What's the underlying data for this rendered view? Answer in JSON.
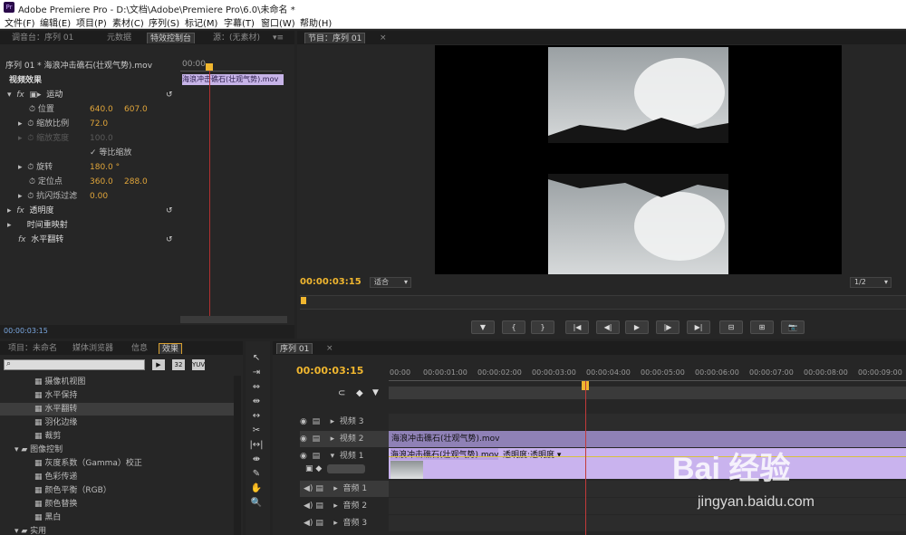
{
  "window": {
    "title": "Adobe Premiere Pro - D:\\文档\\Adobe\\Premiere Pro\\6.0\\未命名 *",
    "app_icon": "Pr"
  },
  "menu": [
    "文件(F)",
    "编辑(E)",
    "项目(P)",
    "素材(C)",
    "序列(S)",
    "标记(M)",
    "字幕(T)",
    "窗口(W)",
    "帮助(H)"
  ],
  "source_tabs": [
    "调音台：序列 01",
    "元数据",
    "特效控制台",
    "源：(无素材)"
  ],
  "effect_controls": {
    "clip_title": "序列 01 * 海浪冲击礁石(壮观气势).mov",
    "timecode_start": "00:00",
    "video_effects": "视频效果",
    "motion": "运动",
    "position": {
      "label": "位置",
      "x": "640.0",
      "y": "607.0"
    },
    "scale": {
      "label": "缩放比例",
      "value": "72.0"
    },
    "scale_width": {
      "label": "缩放宽度",
      "value": "100.0"
    },
    "uniform": "等比缩放",
    "rotation": {
      "label": "旋转",
      "value": "180.0 °"
    },
    "anchor": {
      "label": "定位点",
      "x": "360.0",
      "y": "288.0"
    },
    "antiflicker": {
      "label": "抗闪烁过滤",
      "value": "0.00"
    },
    "opacity": "透明度",
    "time_remap": "时间重映射",
    "hflip": "水平翻转",
    "clip_bar": "海浪冲击礁石(壮观气势).mov",
    "bottom_tc": "00:00:03:15"
  },
  "program": {
    "tab": "节目：序列 01",
    "timecode": "00:00:03:15",
    "fit": "适合",
    "res": "1/2",
    "buttons": [
      "▼",
      "{",
      "}",
      "|◀",
      "◀|",
      "▶",
      "|▶",
      "▶|",
      "⊟",
      "⊞",
      "📷"
    ]
  },
  "project_tabs": [
    "项目：未命名",
    "媒体浏览器",
    "信息",
    "效果"
  ],
  "effects_list": [
    {
      "label": "摄像机视图",
      "indent": 2
    },
    {
      "label": "水平保持",
      "indent": 2
    },
    {
      "label": "水平翻转",
      "indent": 2,
      "selected": true
    },
    {
      "label": "羽化边缘",
      "indent": 2
    },
    {
      "label": "裁剪",
      "indent": 2
    },
    {
      "label": "图像控制",
      "indent": 1,
      "folder": true
    },
    {
      "label": "灰度系数（Gamma）校正",
      "indent": 2
    },
    {
      "label": "色彩传递",
      "indent": 2
    },
    {
      "label": "颜色平衡（RGB）",
      "indent": 2
    },
    {
      "label": "颜色替换",
      "indent": 2
    },
    {
      "label": "黑白",
      "indent": 2
    },
    {
      "label": "实用",
      "indent": 1,
      "folder": true
    }
  ],
  "timeline": {
    "tab": "序列 01",
    "timecode": "00:00:03:15",
    "ticks": [
      "00:00",
      "00:00:01:00",
      "00:00:02:00",
      "00:00:03:00",
      "00:00:04:00",
      "00:00:05:00",
      "00:00:06:00",
      "00:00:07:00",
      "00:00:08:00",
      "00:00:09:00"
    ],
    "video_tracks": [
      "视频 3",
      "视频 2",
      "视频 1"
    ],
    "audio_tracks": [
      "音频 1",
      "音频 2",
      "音频 3"
    ],
    "clip_v2": "海浪冲击礁石(壮观气势).mov",
    "clip_v1": "海浪冲击礁石(壮观气势).mov",
    "clip_v1_fx": "透明度:透明度 ▾"
  },
  "watermark": {
    "brand": "Bai 经验",
    "url": "jingyan.baidu.com"
  }
}
